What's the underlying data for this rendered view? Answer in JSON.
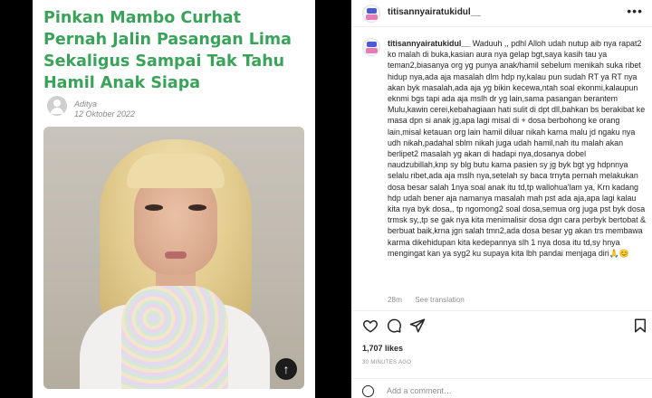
{
  "article": {
    "title": "Pinkan Mambo Curhat Pernah Jalin Pasangan Lima Sekaligus Sampai Tak Tahu Hamil Anak Siapa",
    "author": "Aditya",
    "date": "12 Oktober 2022",
    "scroll_icon": "arrow-up-circle-icon"
  },
  "post": {
    "username": "titisannyairatukidul__",
    "more_label": "•••"
  },
  "comment": {
    "username": "titisannyairatukidul__",
    "text": " Waduuh ,, pdhl Alloh udah nutup aib nya rapat2 ko malah di buka,kasian aura nya gelap bgt,saya kasih tau ya teman2,biasanya org yg punya anak/hamil sebelum menikah suka ribet hidup nya,ada aja masalah dlm hdp ny,kalau pun sudah RT ya RT nya akan byk masalah,ada aja yg bikin kecewa,ntah soal ekonmi,kalaupun eknmi bgs tapi ada aja mslh dr yg lain,sama pasangan berantem Mulu,kawin cerei,kebahagiaan hati sulit di dpt dll,bahkan bs berakibat ke masa dpn si anak jg,apa lagi misal di + dosa berbohong ke orang lain,misal ketauan org lain hamil diluar nikah karna malu jd ngaku nya udh nikah,padahal sblm nikah juga udah hamil,nah itu malah akan berlipet2 masalah yg akan di hadapi nya,dosanya dobel naudzubillah,knp sy blg butu karna pasien sy jg byk bgt yg hdpnnya selalu ribet,ada aja mslh nya,setelah sy baca trnyta pernah melakukan dosa besar salah 1nya soal anak itu td,tp wallohua'lam ya, Krn kadang hdp udah bener aja namanya masalah mah pst ada aja,apa lagi kalau kita nya byk dosa,, tp ngomong2 soal dosa,semua org juga pst byk dosa trmsk sy,,tp se gak nya kita menimalisir dosa dgn cara perbyk bertobat & berbuat baik,krna jgn salah tmn2,ada dosa besar yg akan trs membawa karma dikehidupan kita kedepannya slh 1 nya dosa itu td,sy hnya mengingat kan ya syg2 ku supaya kita lbh pandai menjaga diri🙏😊",
    "time": "28m",
    "translate": "See translation"
  },
  "actions": {
    "like_icon": "heart-icon",
    "comment_icon": "comment-icon",
    "share_icon": "paper-plane-icon",
    "save_icon": "bookmark-icon"
  },
  "likes": "1,707 likes",
  "time_ago": "30 MINUTES AGO",
  "add_comment": {
    "placeholder": "Add a comment…",
    "emoji_icon": "smiley-icon"
  },
  "colors": {
    "title_green": "#3aa35a",
    "background": "#000000",
    "panel": "#ffffff",
    "muted": "#8e8e8e"
  }
}
